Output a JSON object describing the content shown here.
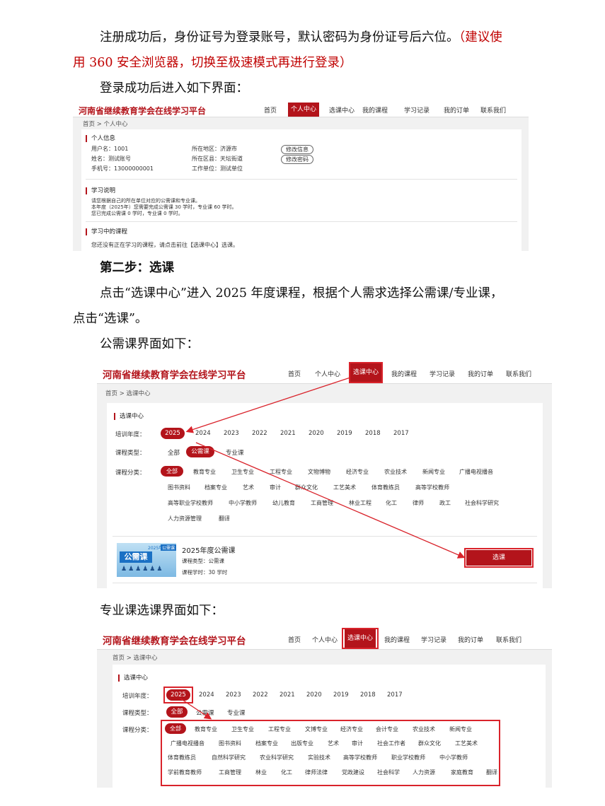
{
  "paragraphs": {
    "p1": "注册成功后，身份证号为登录账号，默认密码为身份证号后六位。",
    "p1_red": "（建议使",
    "p2_red": "用 360 安全浏览器，切换至极速模式再进行登录）",
    "p3": "登录成功后进入如下界面：",
    "step2": "第二步：选课",
    "p4": "点击“选课中心”进入 2025 年度课程，根据个人需求选择公需课/专业课，",
    "p5": "点击“选课”。",
    "p6": "公需课界面如下：",
    "p7": "专业课选课界面如下："
  },
  "platform": {
    "brand": "河南省继续教育学会在线学习平台",
    "nav": [
      "首页",
      "个人中心",
      "选课中心",
      "我的课程",
      "学习记录",
      "我的订单",
      "联系我们"
    ]
  },
  "shot1": {
    "breadcrumb": "首页 > 个人中心",
    "section_info": "个人信息",
    "info": {
      "username": "用户名：1001",
      "name": "姓名：测试账号",
      "phone": "手机号：13000000001",
      "region": "所在地区：济源市",
      "dept": "所在区县：天坛街道",
      "work": "工作单位：测试单位"
    },
    "btn_edit_info": "修改信息",
    "btn_edit_pwd": "修改密码",
    "section_study": "学习说明",
    "study_lines": [
      "请您根据自己的所在单位对应的公需课和专业课。",
      "本年度（2025年）您需要完成公需课 30 学时，专业课 60 学时。",
      "您已完成公需课 0 学时，专业课 0 学时。"
    ],
    "section_courses": "学习中的课程",
    "courses_text": "您还没有正在学习的课程，请点击前往【选课中心】选课。"
  },
  "shot2": {
    "breadcrumb": "首页 > 选课中心",
    "section": "选课中心",
    "year_label": "培训年度：",
    "years": [
      "2025",
      "2024",
      "2023",
      "2022",
      "2021",
      "2020",
      "2019",
      "2018",
      "2017"
    ],
    "type_label": "课程类型：",
    "types": [
      "全部",
      "公需课",
      "专业课"
    ],
    "cat_label": "课程分类：",
    "cat_rows": [
      [
        "全部",
        "教育专业",
        "卫生专业",
        "工程专业",
        "文物博物",
        "经济专业",
        "农业技术",
        "新闻专业",
        "广播电视播音"
      ],
      [
        "图书资料",
        "档案专业",
        "艺术",
        "审计",
        "群众文化",
        "工艺美术",
        "体育教练员",
        "高等学校教师"
      ],
      [
        "高等职业学校教师",
        "中小学教师",
        "幼儿教育",
        "工商管理",
        "林业工程",
        "化工",
        "律师",
        "政工",
        "社会科学研究"
      ],
      [
        "人力资源管理",
        "翻译"
      ]
    ],
    "course": {
      "thumb_label": "公需课",
      "thumb_top": "2025年",
      "thumb_badge": "公需课",
      "title": "2025年度公需课",
      "type": "课程类型：公需课",
      "hours": "课程学时：30 学时",
      "select_btn": "选课"
    }
  },
  "shot3": {
    "breadcrumb": "首页 > 选课中心",
    "section": "选课中心",
    "year_label": "培训年度：",
    "years": [
      "2025",
      "2024",
      "2023",
      "2022",
      "2021",
      "2020",
      "2019",
      "2018",
      "2017"
    ],
    "type_label": "课程类型：",
    "types": [
      "全部",
      "公需课",
      "专业课"
    ],
    "cat_label": "课程分类：",
    "cat_rows": [
      [
        "全部",
        "教育专业",
        "卫生专业",
        "工程专业",
        "文博专业",
        "经济专业",
        "会计专业",
        "农业技术",
        "新闻专业"
      ],
      [
        "广播电视播音",
        "图书资料",
        "档案专业",
        "出版专业",
        "艺术",
        "审计",
        "社会工作者",
        "群众文化",
        "工艺美术"
      ],
      [
        "体育教练员",
        "自然科学研究",
        "农业科学研究",
        "实验技术",
        "高等学校教师",
        "职业学校教师",
        "中小学教师"
      ],
      [
        "学前教育教师",
        "工商管理",
        "林业",
        "化工",
        "律师法律",
        "党政建设",
        "社会科学",
        "人力资源",
        "家庭教育",
        "翻译"
      ]
    ]
  },
  "colors": {
    "accent": "#b3141b",
    "highlight": "#d9232b",
    "note_red": "#c00000"
  }
}
